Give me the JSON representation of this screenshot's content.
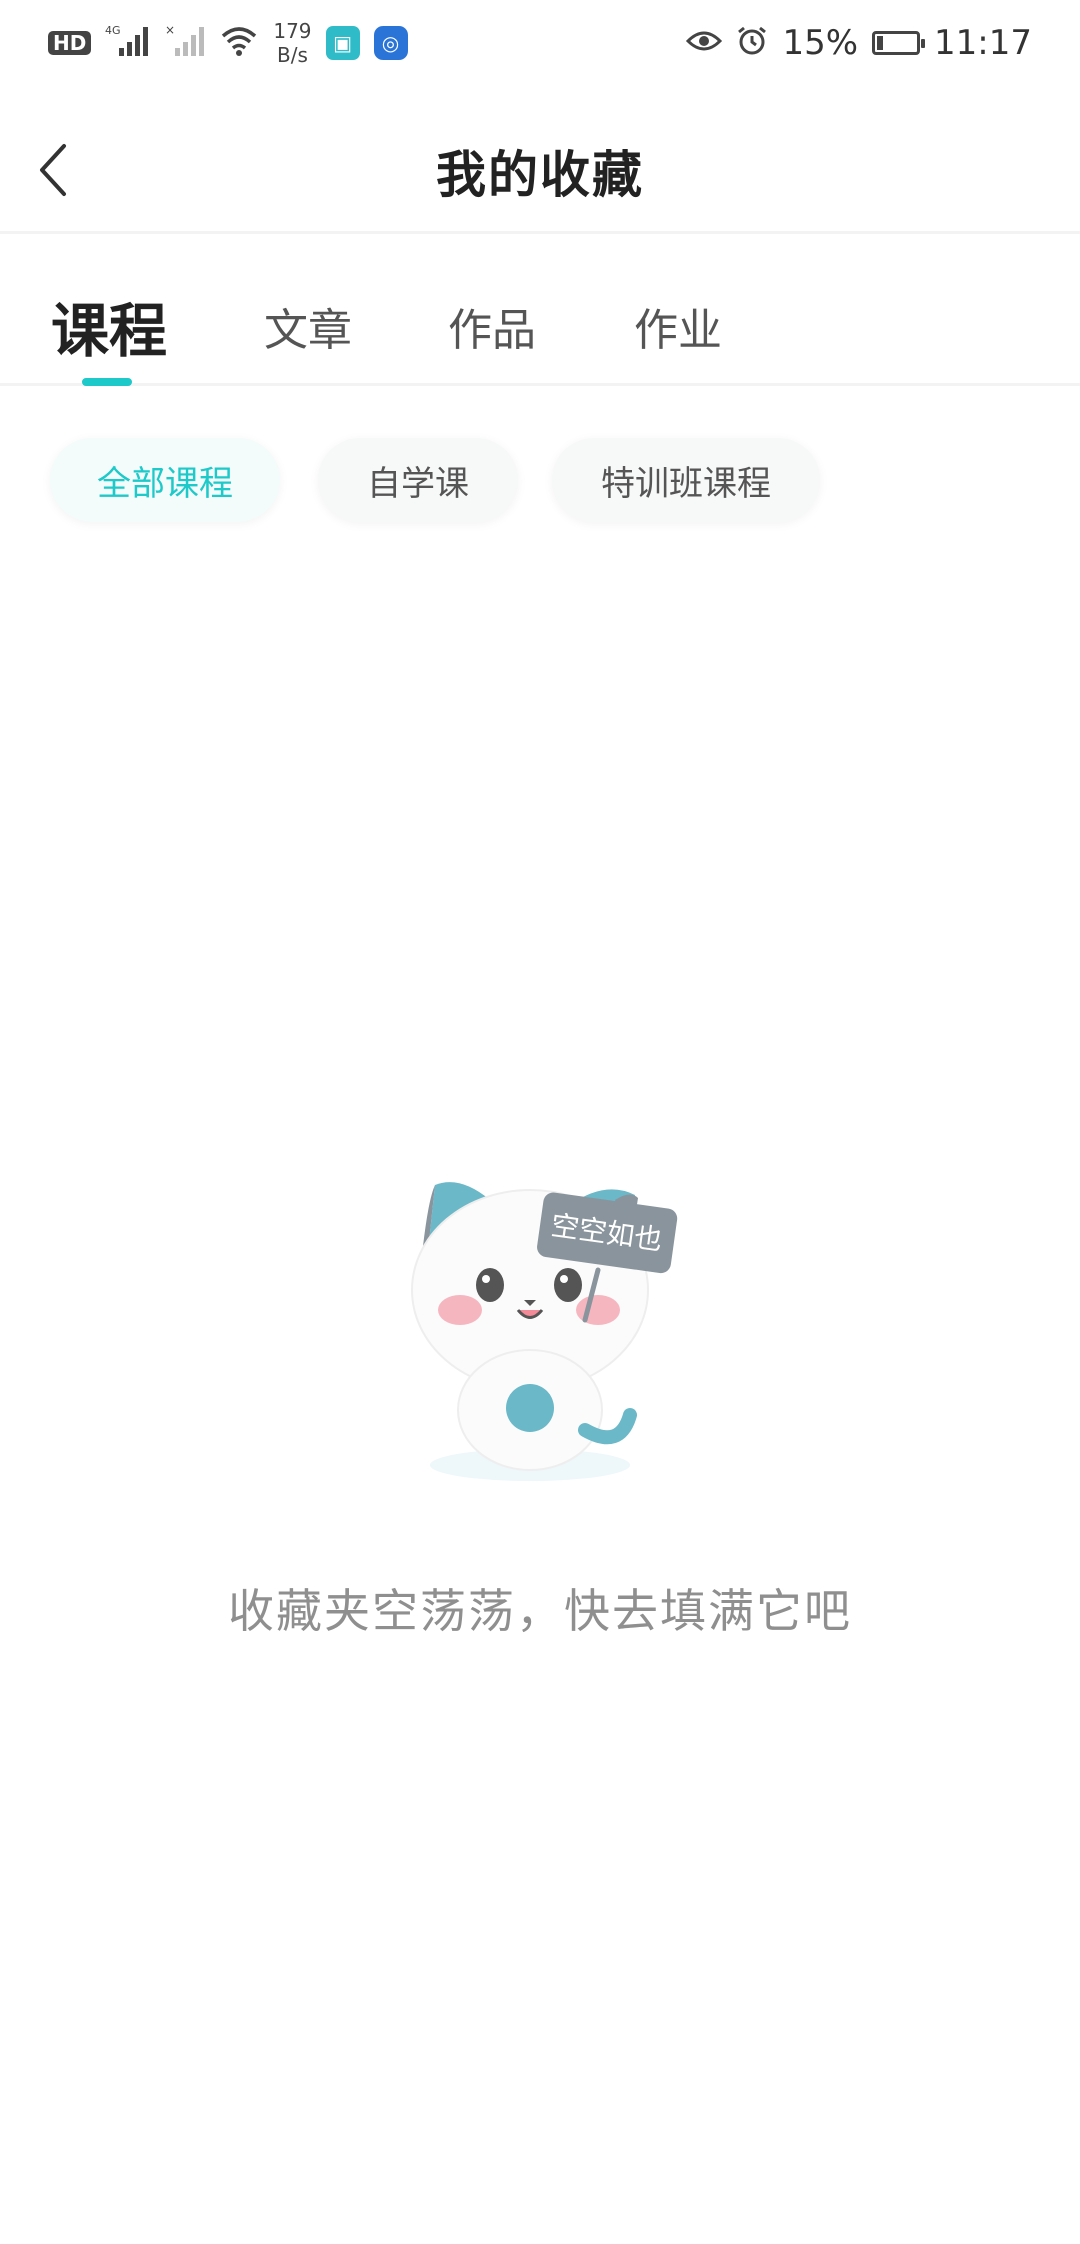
{
  "status_bar": {
    "hd": "HD",
    "network": "4G",
    "speed_value": "179",
    "speed_unit": "B/s",
    "battery": "15%",
    "battery_level": 0.15,
    "time": "11:17"
  },
  "header": {
    "title": "我的收藏"
  },
  "tabs": [
    {
      "label": "课程",
      "active": true
    },
    {
      "label": "文章",
      "active": false
    },
    {
      "label": "作品",
      "active": false
    },
    {
      "label": "作业",
      "active": false
    }
  ],
  "filters": [
    {
      "label": "全部课程",
      "active": true
    },
    {
      "label": "自学课",
      "active": false
    },
    {
      "label": "特训班课程",
      "active": false
    }
  ],
  "empty_state": {
    "sign_text": "空空如也",
    "message": "收藏夹空荡荡，快去填满它吧"
  },
  "colors": {
    "accent": "#1ec9c9",
    "text_primary": "#222222",
    "text_secondary": "#555555",
    "text_hint": "#8f8f8f",
    "mascot_blue": "#6bb8c8"
  }
}
